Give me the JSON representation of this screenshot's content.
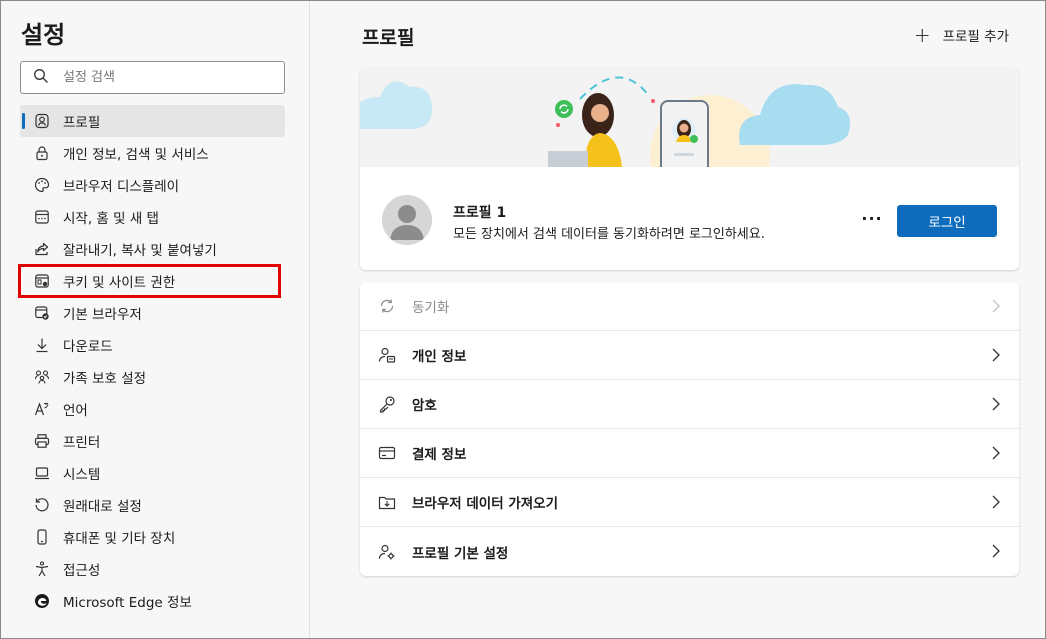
{
  "sidebar": {
    "title": "설정",
    "search_placeholder": "설정 검색",
    "items": [
      {
        "label": "프로필",
        "icon": "profile-icon",
        "active": true
      },
      {
        "label": "개인 정보, 검색 및 서비스",
        "icon": "lock-icon"
      },
      {
        "label": "브라우저 디스플레이",
        "icon": "palette-icon"
      },
      {
        "label": "시작, 홈 및 새 탭",
        "icon": "home-tabs-icon"
      },
      {
        "label": "잘라내기, 복사 및 붙여넣기",
        "icon": "share-icon"
      },
      {
        "label": "쿠키 및 사이트 권한",
        "icon": "site-permissions-icon"
      },
      {
        "label": "기본 브라우저",
        "icon": "default-browser-icon"
      },
      {
        "label": "다운로드",
        "icon": "download-icon"
      },
      {
        "label": "가족 보호 설정",
        "icon": "family-icon"
      },
      {
        "label": "언어",
        "icon": "language-icon"
      },
      {
        "label": "프린터",
        "icon": "printer-icon"
      },
      {
        "label": "시스템",
        "icon": "system-icon"
      },
      {
        "label": "원래대로 설정",
        "icon": "reset-icon"
      },
      {
        "label": "휴대폰 및 기타 장치",
        "icon": "phone-icon"
      },
      {
        "label": "접근성",
        "icon": "accessibility-icon"
      },
      {
        "label": "Microsoft Edge 정보",
        "icon": "edge-logo-icon"
      }
    ]
  },
  "main": {
    "title": "프로필",
    "add_profile_label": "프로필 추가",
    "profile": {
      "name": "프로필 1",
      "description": "모든 장치에서 검색 데이터를 동기화하려면 로그인하세요.",
      "more_label": "···",
      "login_label": "로그인"
    },
    "rows": [
      {
        "label": "동기화",
        "icon": "sync-icon",
        "disabled": true
      },
      {
        "label": "개인 정보",
        "icon": "personal-info-icon"
      },
      {
        "label": "암호",
        "icon": "key-icon"
      },
      {
        "label": "결제 정보",
        "icon": "card-icon"
      },
      {
        "label": "브라우저 데이터 가져오기",
        "icon": "import-icon"
      },
      {
        "label": "프로필 기본 설정",
        "icon": "profile-prefs-icon"
      }
    ]
  },
  "colors": {
    "accent": "#0f6cbd",
    "highlight": "#e30000"
  }
}
